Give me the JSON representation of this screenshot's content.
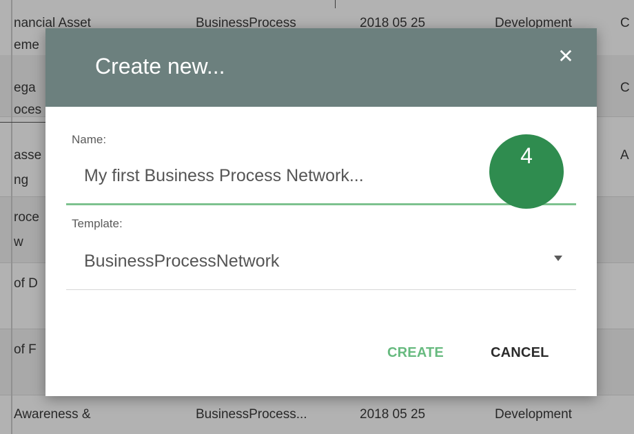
{
  "background_table": {
    "rows": [
      {
        "col1": [
          "nancial Asset",
          "eme"
        ],
        "col2": "BusinessProcess",
        "col3": "2018 05 25",
        "col4": "Development",
        "col5": "C"
      },
      {
        "col1": [
          "ega",
          "oces"
        ],
        "col2": "",
        "col3": "",
        "col4": "",
        "col5": "C"
      },
      {
        "col1": [
          "asse",
          "ng"
        ],
        "col2": "",
        "col3": "",
        "col4": "",
        "col5": "A"
      },
      {
        "col1": [
          "roce",
          "w"
        ],
        "col2": "",
        "col3": "",
        "col4": "",
        "col5": ""
      },
      {
        "col1": [
          "of D",
          ""
        ],
        "col2": "",
        "col3": "",
        "col4": "",
        "col5": ""
      },
      {
        "col1": [
          "of F",
          ""
        ],
        "col2": "",
        "col3": "",
        "col4": "",
        "col5": ""
      },
      {
        "col1": [
          "Awareness &",
          ""
        ],
        "col2": "BusinessProcess...",
        "col3": "2018 05 25",
        "col4": "Development",
        "col5": ""
      }
    ]
  },
  "dialog": {
    "title": "Create new...",
    "close_icon": "close-icon",
    "name_label": "Name:",
    "name_value": "My first Business Process Network...",
    "template_label": "Template:",
    "template_value": "BusinessProcessNetwork",
    "create_label": "CREATE",
    "cancel_label": "CANCEL"
  },
  "step_badge": "4",
  "colors": {
    "header": "#6c807e",
    "accent_green": "#67ba7f",
    "badge": "#2f8c4f"
  }
}
